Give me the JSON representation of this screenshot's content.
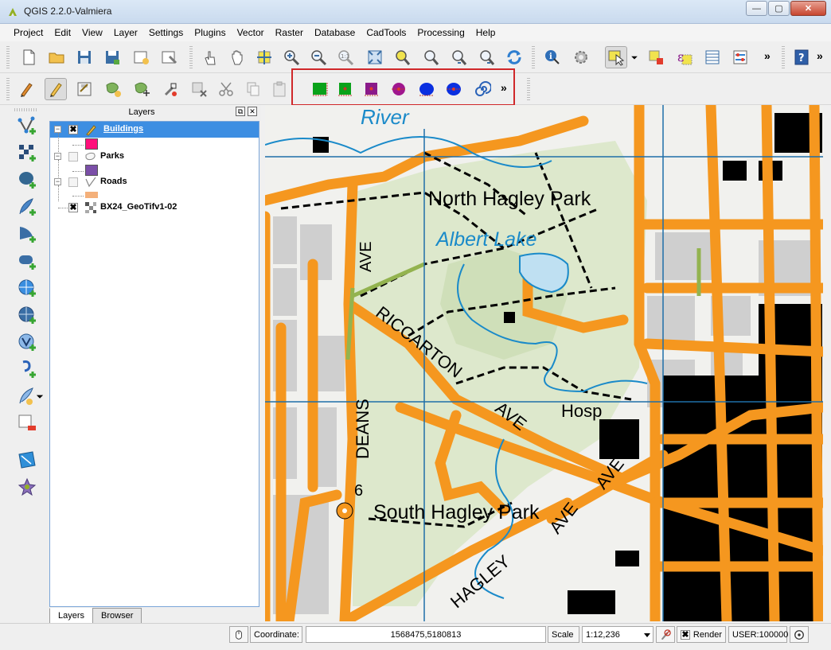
{
  "window": {
    "title": "QGIS 2.2.0-Valmiera",
    "min": "0",
    "max": "1",
    "close": "x"
  },
  "menu": [
    "Project",
    "Edit",
    "View",
    "Layer",
    "Settings",
    "Plugins",
    "Vector",
    "Raster",
    "Database",
    "CadTools",
    "Processing",
    "Help"
  ],
  "toolbar": {
    "overflow": "»",
    "overflow2": "»",
    "overflow3": "»"
  },
  "panel": {
    "title": "Layers",
    "layers": [
      {
        "name": "Buildings",
        "checked": true,
        "color": "#ff0f7b"
      },
      {
        "name": "Parks",
        "checked": false,
        "color": "#7b4fa8"
      },
      {
        "name": "Roads",
        "checked": false,
        "color": "#f4b07a"
      },
      {
        "name": "BX24_GeoTifv1-02",
        "checked": true
      }
    ],
    "tabs": [
      "Layers",
      "Browser"
    ]
  },
  "map": {
    "labels": [
      "River",
      "North Hagley Park",
      "Albert Lake",
      "AVE",
      "RICCARTON",
      "AVE",
      "Hosp",
      "DEANS",
      "AVE",
      "6",
      "South Hagley Park",
      "AVE",
      "HAGLEY"
    ],
    "colors": {
      "road": "#f5971f",
      "park": "#dde8cc",
      "water": "#1a8ac9",
      "building": "#000000",
      "block": "#cfcfcf"
    }
  },
  "status": {
    "coordinate_label": "Coordinate:",
    "coordinate_value": "1568475,5180813",
    "scale_label": "Scale",
    "scale_value": "1:12,236",
    "render_label": "Render",
    "render_checked": "✖",
    "crs": "USER:100000"
  }
}
